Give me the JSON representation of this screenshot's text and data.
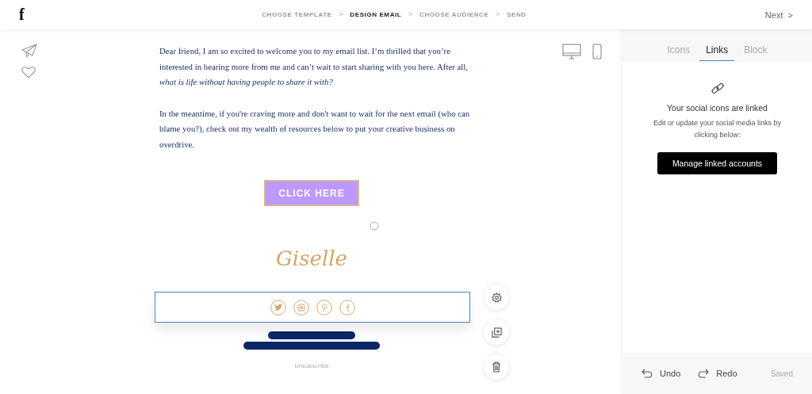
{
  "logo": "f",
  "steps": [
    {
      "label": "CHOOSE TEMPLATE",
      "selected": false
    },
    {
      "label": "DESIGN EMAIL",
      "selected": true
    },
    {
      "label": "CHOOSE AUDIENCE",
      "selected": false
    },
    {
      "label": "SEND",
      "selected": false
    }
  ],
  "step_separators": [
    ">",
    ">",
    ">"
  ],
  "next": {
    "label": "Next",
    "arrow": ">"
  },
  "email": {
    "paragraphs": [
      "Dear friend, I am so excited to welcome you to my email list. I’m thrilled that you’re interested in hearing more from me and can’t wait to start sharing with you here. After all, *what is life without having people to share it with?*",
      "In the meantime, if you're craving more and don't want to wait for the next email (who can blame you?), check out my wealth of resources below to put your creative business on overdrive."
    ],
    "button": "CLICK HERE",
    "signature": "Giselle",
    "footer_link": "Unsubscribe"
  },
  "panel": {
    "tabs": [
      {
        "label": "Icons",
        "selected": false
      },
      {
        "label": "Links",
        "selected": true
      },
      {
        "label": "Block",
        "selected": false
      }
    ],
    "heading": "Your social icons are linked",
    "description": "Edit or update your social media links by clicking below:",
    "button": "Manage linked accounts"
  },
  "bottom_bar": {
    "undo": "Undo",
    "redo": "Redo",
    "status": "Saved"
  }
}
